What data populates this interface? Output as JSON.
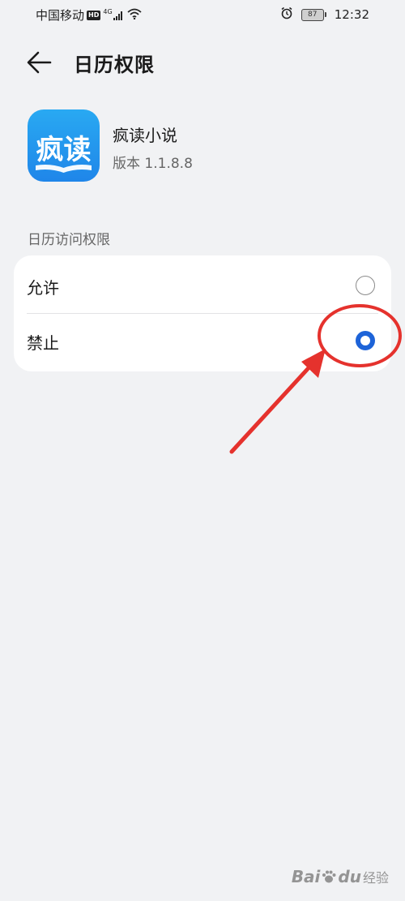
{
  "status_bar": {
    "carrier": "中国移动",
    "hd_badge": "HD",
    "network_badge": "4G",
    "battery_level": "87",
    "time": "12:32",
    "icons": [
      "signal-icon",
      "wifi-icon",
      "alarm-icon",
      "battery-icon"
    ]
  },
  "header": {
    "back_icon": "back-arrow-icon",
    "title": "日历权限"
  },
  "app": {
    "icon_text": "疯读",
    "name": "疯读小说",
    "version": "版本 1.1.8.8"
  },
  "section": {
    "label": "日历访问权限"
  },
  "options": [
    {
      "label": "允许",
      "selected": false
    },
    {
      "label": "禁止",
      "selected": true
    }
  ],
  "colors": {
    "background": "#f1f2f4",
    "card": "#ffffff",
    "accent": "#1d63d8",
    "annotation": "#e5322d",
    "app_icon": "#1f86e9"
  },
  "watermark": {
    "brand": "Bai",
    "brand_suffix": "du",
    "service": "经验"
  }
}
